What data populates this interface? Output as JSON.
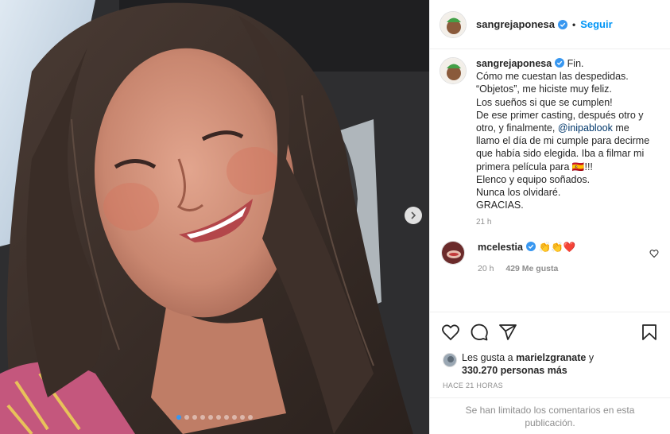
{
  "post": {
    "author": "sangrejaponesa",
    "follow_label": "Seguir",
    "separator": "•",
    "caption_lines": [
      "Fin.",
      "Cómo me cuestan las despedidas.",
      "“Objetos”, me hiciste muy feliz.",
      "Los sueños si que se cumplen!",
      "De ese primer casting, después otro y",
      "otro, y finalmente,",
      "@inipablook",
      "me",
      "llamo el día de mi cumple para decirme",
      "que había sido elegida. Iba a filmar mi",
      "primera película para",
      "🇪🇸",
      "!!!",
      "Elenco y equipo soñados.",
      "Nunca los olvidaré.",
      "GRACIAS."
    ],
    "caption_time": "21 h",
    "comment": {
      "user": "mcelestia",
      "text": "👏👏❤️",
      "time": "20 h",
      "likes": "429 Me gusta"
    },
    "likes": {
      "prefix": "Les gusta a",
      "user": "marielzgranate",
      "joiner": "y",
      "count": "330.270 personas más"
    },
    "posted_ago": "HACE 21 HORAS",
    "comments_disabled": "Se han limitado los comentarios en esta publicación."
  },
  "carousel": {
    "total_slides": 10,
    "active_index": 0
  },
  "colors": {
    "accent": "#0095f6",
    "verified": "#3897f0",
    "muted": "#8e8e8e"
  },
  "icons": [
    "verified-badge-icon",
    "heart-icon",
    "comment-icon",
    "share-icon",
    "bookmark-icon",
    "chevron-right-icon"
  ]
}
